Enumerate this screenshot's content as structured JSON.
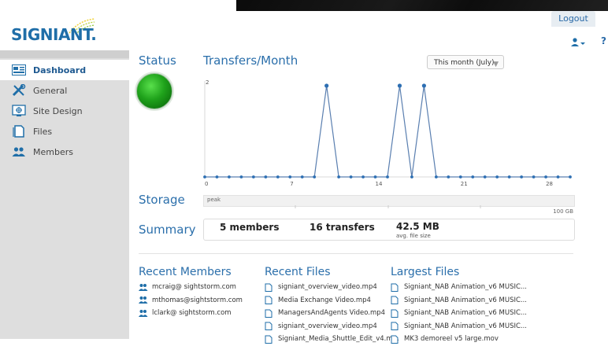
{
  "header": {
    "logo_text": "SIGNIANT.",
    "logout_label": "Logout",
    "help_label": "?"
  },
  "sidebar": {
    "items": [
      {
        "label": "Dashboard",
        "icon": "dashboard-icon",
        "active": true
      },
      {
        "label": "General",
        "icon": "tools-icon",
        "active": false
      },
      {
        "label": "Site Design",
        "icon": "site-design-icon",
        "active": false
      },
      {
        "label": "Files",
        "icon": "files-icon",
        "active": false
      },
      {
        "label": "Members",
        "icon": "members-icon",
        "active": false
      }
    ]
  },
  "status": {
    "title": "Status",
    "state_color": "#1fa21b"
  },
  "transfers": {
    "title": "Transfers/Month",
    "period_select": "This month (July)"
  },
  "storage": {
    "title": "Storage",
    "bar_label": "peak",
    "capacity_label": "100 GB"
  },
  "summary": {
    "title": "Summary",
    "members": "5 members",
    "transfers": "16 transfers",
    "avg_size": "42.5 MB",
    "avg_size_label": "avg. file size"
  },
  "recent_members": {
    "title": "Recent Members",
    "items": [
      "mcraig@ sightstorm.com",
      "mthomas@sightstorm.com",
      "lclark@ sightstorm.com"
    ]
  },
  "recent_files": {
    "title": "Recent Files",
    "items": [
      "signiant_overview_video.mp4",
      "Media Exchange Video.mp4",
      "ManagersAndAgents Video.mp4",
      "signiant_overview_video.mp4",
      "Signiant_Media_Shuttle_Edit_v4.m..."
    ]
  },
  "largest_files": {
    "title": "Largest Files",
    "items": [
      "Signiant_NAB Animation_v6 MUSIC...",
      "Signiant_NAB Animation_v6 MUSIC...",
      "Signiant_NAB Animation_v6 MUSIC...",
      "Signiant_NAB Animation_v6 MUSIC...",
      "MK3 demoreel v5 large.mov"
    ]
  },
  "chart_data": {
    "type": "line",
    "title": "",
    "xlabel": "",
    "ylabel": "",
    "x": [
      0,
      1,
      2,
      3,
      4,
      5,
      6,
      7,
      8,
      9,
      10,
      11,
      12,
      13,
      14,
      15,
      16,
      17,
      18,
      19,
      20,
      21,
      22,
      23,
      24,
      25,
      26,
      27,
      28,
      29,
      30
    ],
    "series": [
      {
        "values": [
          0,
          0,
          0,
          0,
          0,
          0,
          0,
          0,
          0,
          0,
          2,
          0,
          0,
          0,
          0,
          0,
          2,
          0,
          2,
          0,
          0,
          0,
          0,
          0,
          0,
          0,
          0,
          0,
          0,
          0,
          0
        ]
      }
    ],
    "x_ticks": [
      0,
      7,
      14,
      21,
      28
    ],
    "y_ticks": [
      0,
      2
    ],
    "ylim": [
      0,
      2
    ],
    "xlim": [
      0,
      30
    ],
    "line_color": "#5a7fb0",
    "point_color": "#2d6fb3",
    "grid": false
  }
}
